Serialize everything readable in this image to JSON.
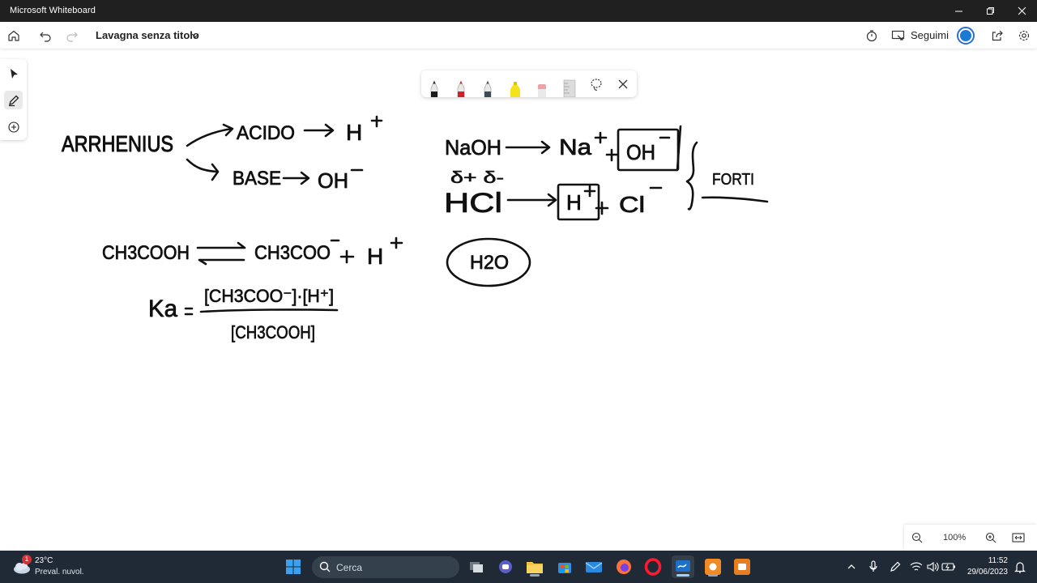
{
  "window": {
    "title": "Microsoft Whiteboard",
    "minimize_icon": "minimize-icon",
    "restore_icon": "restore-icon",
    "close_icon": "close-icon"
  },
  "appbar": {
    "board_title": "Lavagna senza titolo",
    "follow_label": "Seguimi",
    "icons": [
      "home-icon",
      "undo-icon",
      "redo-icon",
      "chevron-down-icon",
      "timer-icon",
      "present-icon",
      "share-icon",
      "settings-icon"
    ]
  },
  "rail": {
    "tools": [
      "select-icon",
      "pen-icon",
      "add-icon"
    ],
    "active": "pen-icon"
  },
  "palette": {
    "pens": [
      {
        "name": "black-pen",
        "color": "#1a1a1a"
      },
      {
        "name": "red-pen",
        "color": "#d0202a"
      },
      {
        "name": "blue-gray-pen",
        "color": "#3b4a5a"
      },
      {
        "name": "yellow-highlighter",
        "color": "#f4e21a"
      },
      {
        "name": "eraser",
        "color": "#f0a0a6"
      },
      {
        "name": "ruler",
        "color": "#bdbdbd"
      }
    ],
    "icons": [
      "lasso-icon",
      "close-icon"
    ]
  },
  "canvas": {
    "notes": {
      "arrhenius": "ARRHENIUS",
      "acido": "ACIDO",
      "h_plus": "H",
      "base": "BASE",
      "oh_minus": "OH",
      "naoh": "NaOH",
      "na_plus": "Na",
      "oh_boxed": "OH",
      "delta_signs": "δ+ δ-",
      "hcl": "HCl",
      "h_boxed": "H",
      "cl_minus": "Cl",
      "forti": "FORTI",
      "ch3cooh": "CH3COOH",
      "ch3coo_minus": "CH3COO",
      "h_plus_2": "H",
      "h2o": "H2O",
      "ka": "Ka",
      "ka_numerator": "[CH3COO⁻]·[H⁺]",
      "ka_denominator": "[CH3COOH]"
    }
  },
  "zoom": {
    "value": "100%",
    "icons": [
      "zoom-out-icon",
      "zoom-in-icon",
      "fit-icon"
    ]
  },
  "taskbar": {
    "weather_temp": "23°C",
    "weather_desc": "Preval. nuvol.",
    "weather_badge": "1",
    "search_placeholder": "Cerca",
    "apps": [
      "start-icon",
      "task-view-icon",
      "teams-icon",
      "file-explorer-icon",
      "store-icon",
      "mail-icon",
      "firefox-icon",
      "opera-icon",
      "whiteboard-icon",
      "app-orange-icon",
      "app-orange2-icon"
    ],
    "tray": [
      "chevron-up-icon",
      "mic-icon",
      "pen-tray-icon",
      "wifi-icon",
      "volume-icon",
      "battery-icon"
    ],
    "time": "11:52",
    "date": "29/06/2023",
    "notification_icon": "notification-icon"
  }
}
